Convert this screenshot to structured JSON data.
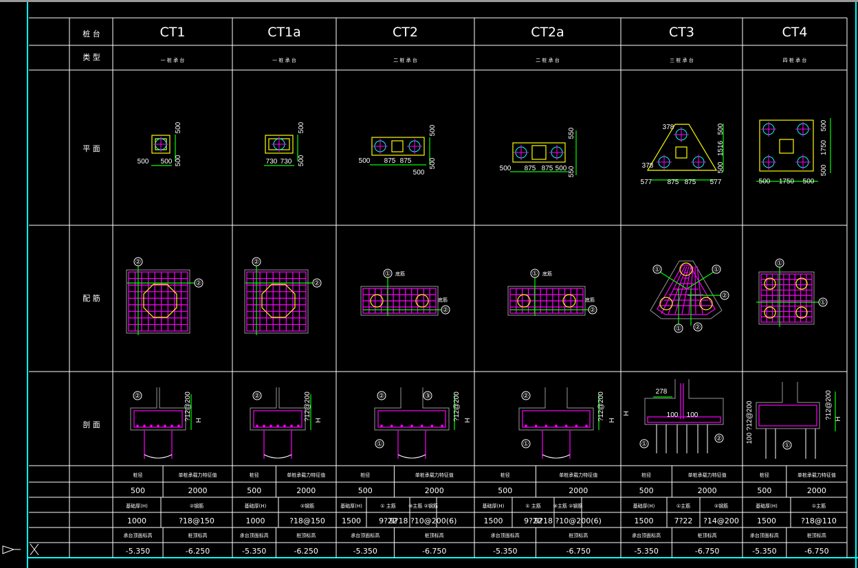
{
  "row_labels": {
    "row1_a": "桩台",
    "row2_a": "类型",
    "plan": "平面",
    "rebar": "配筋",
    "section": "剖面"
  },
  "columns": [
    {
      "name": "CT1",
      "type_label": "一 桩 承 台",
      "diameter": "500",
      "capacity": "2000",
      "p1_label": "基础厚(H)",
      "p1": "1000",
      "p2_label": "②钢筋",
      "p2": "?18@150",
      "p3_label": "",
      "p3": "",
      "top_elev": "-5.350",
      "bottom_elev": "-6.250",
      "plan_dims": [
        "500",
        "500",
        "500",
        "500"
      ]
    },
    {
      "name": "CT1a",
      "type_label": "一 桩 承 台",
      "diameter": "500",
      "capacity": "2000",
      "p1_label": "基础厚(H)",
      "p1": "1000",
      "p2_label": "②钢筋",
      "p2": "?18@150",
      "p3_label": "",
      "p3": "",
      "top_elev": "-5.350",
      "bottom_elev": "-6.250",
      "plan_dims": [
        "500",
        "500",
        "730",
        "730"
      ]
    },
    {
      "name": "CT2",
      "type_label": "二 桩 承 台",
      "diameter": "500",
      "capacity": "2000",
      "p1_label": "基础厚(H)",
      "p1": "1500",
      "p2_label": "① 主筋",
      "p2": "9?22",
      "p3_label": "③主筋 ②钢筋",
      "p3": "9?18 ?10@200(6)",
      "top_elev": "-5.350",
      "bottom_elev": "-6.750",
      "plan_dims": [
        "500",
        "500",
        "875",
        "875",
        "500",
        "500"
      ]
    },
    {
      "name": "CT2a",
      "type_label": "二 桩 承 台",
      "diameter": "500",
      "capacity": "2000",
      "p1_label": "基础厚(H)",
      "p1": "1500",
      "p2_label": "① 主筋",
      "p2": "9?22",
      "p3_label": "③主筋 ②钢筋",
      "p3": "9?18 ?10@200(6)",
      "top_elev": "-5.350",
      "bottom_elev": "-6.750",
      "plan_dims": [
        "550",
        "550",
        "500",
        "875",
        "875",
        "500"
      ]
    },
    {
      "name": "CT3",
      "type_label": "三 桩 承 台",
      "diameter": "500",
      "capacity": "2000",
      "p1_label": "基础厚(H)",
      "p1": "1500",
      "p2_label": "①主筋",
      "p2": "7?22",
      "p3_label": "②钢筋",
      "p3": "?14@200",
      "top_elev": "-5.350",
      "bottom_elev": "-6.750",
      "plan_dims": [
        "500",
        "1516",
        "500",
        "577",
        "875",
        "875",
        "577",
        "378",
        "378"
      ]
    },
    {
      "name": "CT4",
      "type_label": "四 桩 承 台",
      "diameter": "500",
      "capacity": "2000",
      "p1_label": "基础厚(H)",
      "p1": "1500",
      "p2_label": "①主筋",
      "p2": "?18@110",
      "p3_label": "",
      "p3": "",
      "top_elev": "-5.350",
      "bottom_elev": "-6.750",
      "plan_dims": [
        "500",
        "1750",
        "500",
        "500",
        "1750",
        "500"
      ]
    }
  ],
  "param_headers": {
    "diameter": "桩径",
    "capacity": "单桩承载力特征值",
    "top_elev": "承台顶面标高",
    "bottom_elev": "桩顶标高"
  },
  "section_labels": {
    "ct1_rebar": "?12@200",
    "ct3_dim": "278",
    "ct3_100a": "100",
    "ct3_100b": "100",
    "h_label": "H",
    "ct4_left": "100 ?12@200",
    "ct4_right": "?12@200"
  },
  "rebar_notes": {
    "side_label": "底筋",
    "marker1": "①",
    "marker2": "②",
    "marker3": "③"
  },
  "colors": {
    "background": "#000000",
    "border": "#00ffff",
    "grid": "#ffffff",
    "rebar": "#ff00ff",
    "dims": "#00ff00",
    "outline": "#ffff00"
  }
}
